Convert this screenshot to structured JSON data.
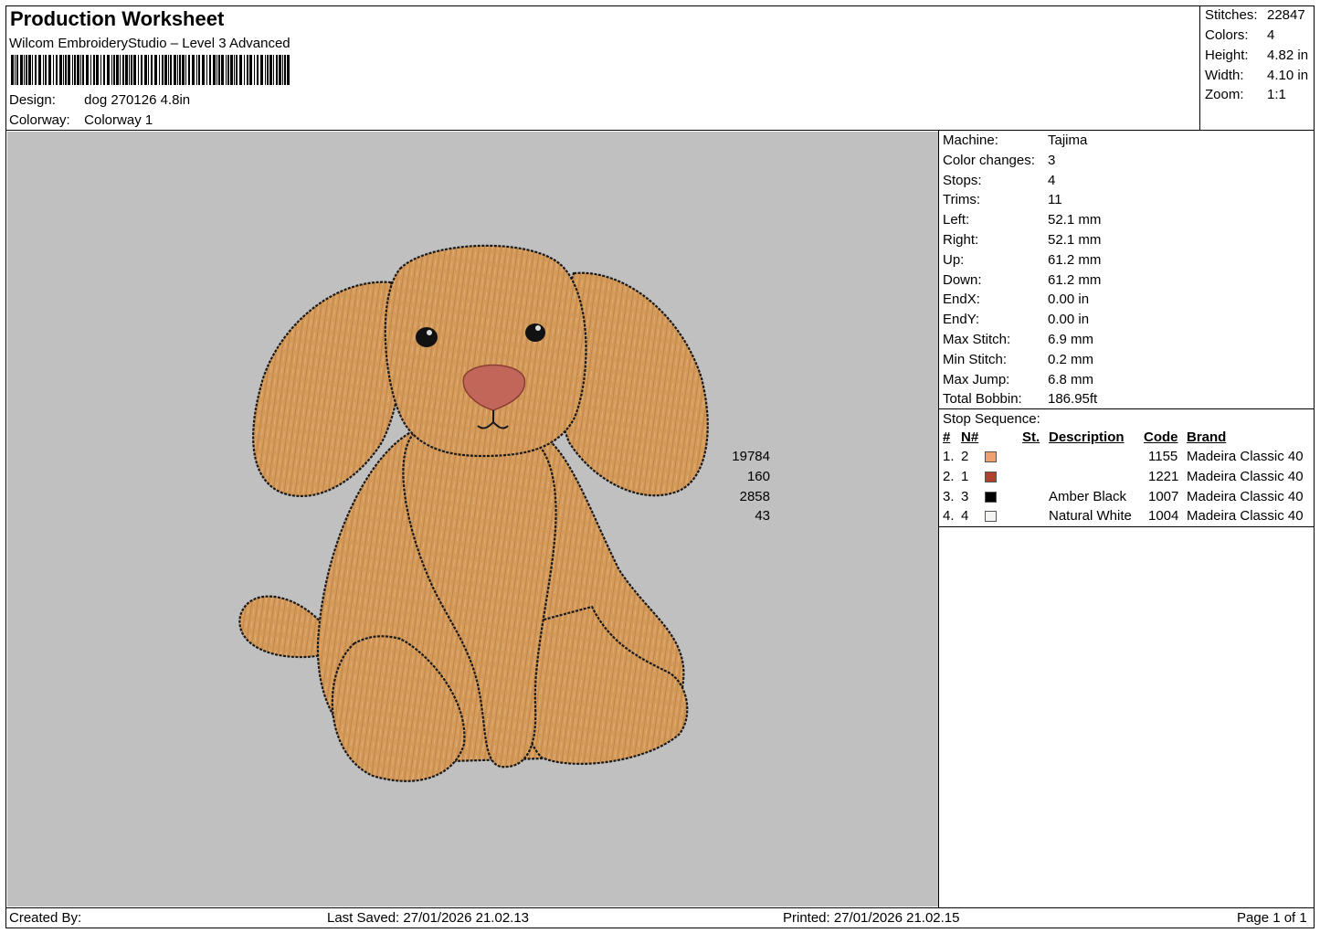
{
  "header": {
    "title": "Production Worksheet",
    "software": "Wilcom EmbroideryStudio – Level 3 Advanced",
    "design_label": "Design:",
    "design_value": "dog 270126 4.8in",
    "colorway_label": "Colorway:",
    "colorway_value": "Colorway 1"
  },
  "stats": {
    "stitches_label": "Stitches:",
    "stitches": "22847",
    "colors_label": "Colors:",
    "colors": "4",
    "height_label": "Height:",
    "height": "4.82 in",
    "width_label": "Width:",
    "width": "4.10 in",
    "zoom_label": "Zoom:",
    "zoom": "1:1"
  },
  "machine_info": [
    {
      "label": "Machine:",
      "value": "Tajima"
    },
    {
      "label": "Color changes:",
      "value": "3"
    },
    {
      "label": "Stops:",
      "value": "4"
    },
    {
      "label": "Trims:",
      "value": "11"
    },
    {
      "label": "Left:",
      "value": "52.1 mm"
    },
    {
      "label": "Right:",
      "value": "52.1 mm"
    },
    {
      "label": "Up:",
      "value": "61.2 mm"
    },
    {
      "label": "Down:",
      "value": "61.2 mm"
    },
    {
      "label": "EndX:",
      "value": "0.00 in"
    },
    {
      "label": "EndY:",
      "value": "0.00 in"
    },
    {
      "label": "Max Stitch:",
      "value": "6.9 mm"
    },
    {
      "label": "Min Stitch:",
      "value": "0.2 mm"
    },
    {
      "label": "Max Jump:",
      "value": "6.8 mm"
    },
    {
      "label": "Total Bobbin:",
      "value": "186.95ft"
    }
  ],
  "stop_sequence": {
    "title": "Stop Sequence:",
    "headers": {
      "num": "#",
      "n": "N#",
      "st": "St.",
      "description": "Description",
      "code": "Code",
      "brand": "Brand"
    },
    "rows": [
      {
        "num": "1.",
        "n": "2",
        "color": "#f0a070",
        "st": "19784",
        "description": "",
        "code": "1155",
        "brand": "Madeira Classic 40"
      },
      {
        "num": "2.",
        "n": "1",
        "color": "#b04030",
        "st": "160",
        "description": "",
        "code": "1221",
        "brand": "Madeira Classic 40"
      },
      {
        "num": "3.",
        "n": "3",
        "color": "#000000",
        "st": "2858",
        "description": "Amber Black",
        "code": "1007",
        "brand": "Madeira Classic 40"
      },
      {
        "num": "4.",
        "n": "4",
        "color": "#f4f4f2",
        "st": "43",
        "description": "Natural White",
        "code": "1004",
        "brand": "Madeira Classic 40"
      }
    ]
  },
  "footer": {
    "created_by": "Created By:",
    "last_saved": "Last Saved: 27/01/2026 21.02.13",
    "printed": "Printed: 27/01/2026 21.02.15",
    "page": "Page 1 of 1"
  },
  "design_preview": {
    "background_color": "#c0c0c0",
    "fill_color": "#d49a5a",
    "outline_color": "#1a1a1a",
    "nose_color": "#c0665a"
  }
}
